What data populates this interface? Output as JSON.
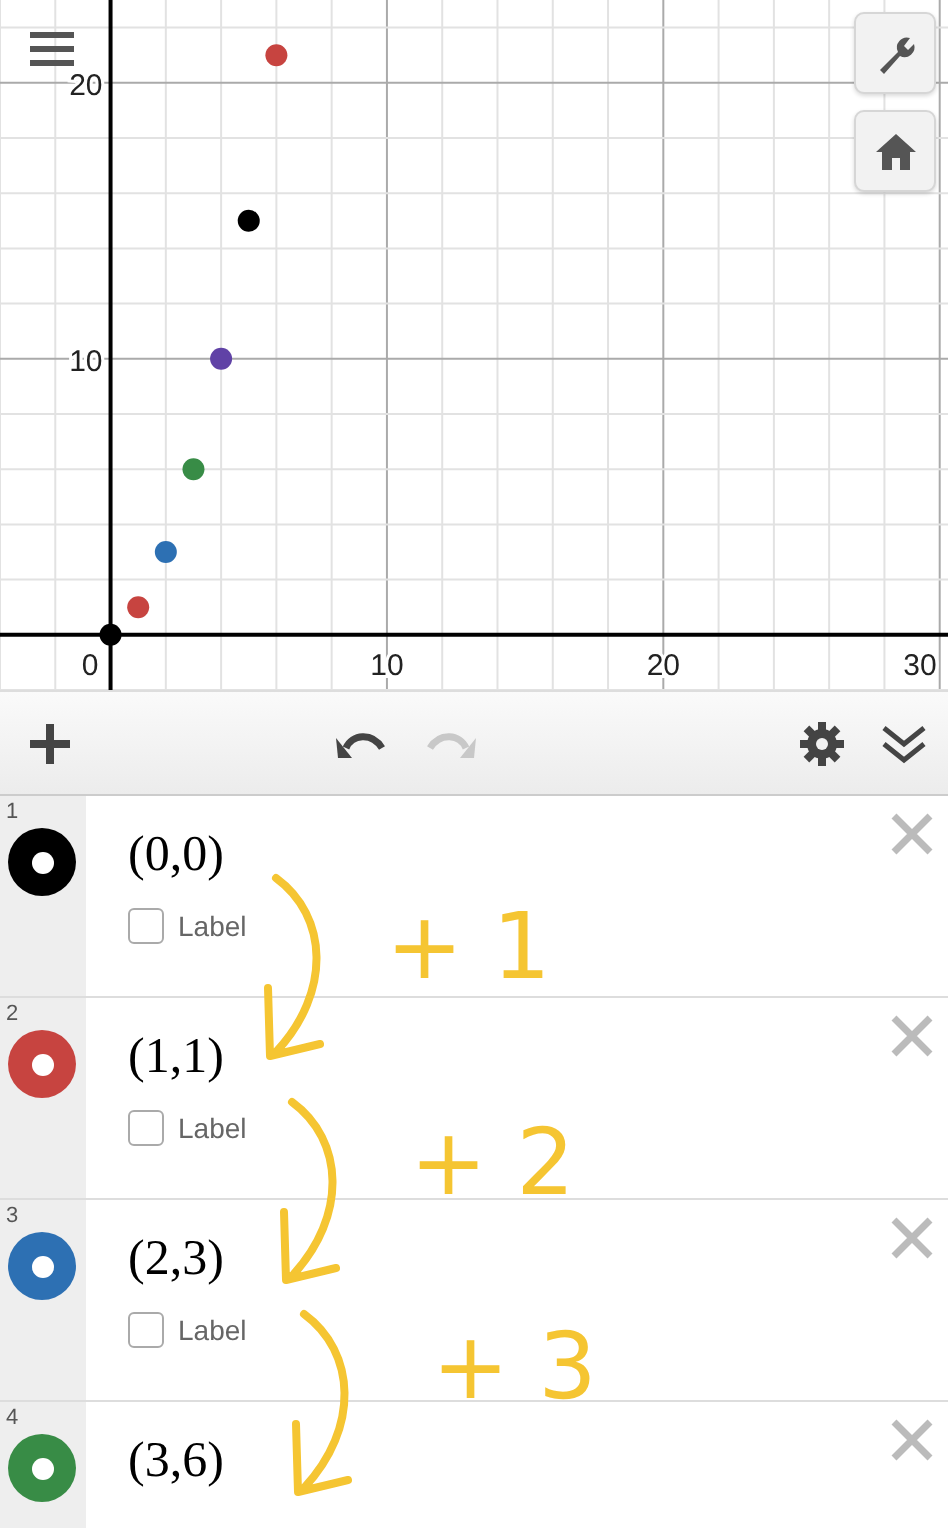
{
  "graph": {
    "chart_data": {
      "type": "scatter",
      "x": [
        0,
        1,
        2,
        3,
        4,
        5,
        6
      ],
      "grid": true,
      "series": [
        {
          "color": "#000000",
          "values": [
            0,
            null,
            null,
            null,
            null,
            15,
            null
          ]
        },
        {
          "color": "#c74440",
          "values": [
            null,
            1,
            null,
            null,
            null,
            null,
            21
          ]
        },
        {
          "color": "#2d70b3",
          "values": [
            null,
            null,
            3,
            null,
            null,
            null,
            null
          ]
        },
        {
          "color": "#388c46",
          "values": [
            null,
            null,
            null,
            6,
            null,
            null,
            null
          ]
        },
        {
          "color": "#6042a6",
          "values": [
            null,
            null,
            null,
            null,
            10,
            null,
            null
          ]
        }
      ],
      "xlim": [
        -4,
        30.3
      ],
      "ylim": [
        -2,
        23
      ],
      "xticks": [
        0,
        10,
        20,
        30
      ],
      "yticks": [
        10,
        20
      ]
    }
  },
  "toolbar": {
    "undo_disabled": false,
    "redo_disabled": true
  },
  "expressions": [
    {
      "number": "1",
      "color": "#000000",
      "expression": "(0,0)",
      "label": {
        "text": "Label",
        "checked": false
      }
    },
    {
      "number": "2",
      "color": "#c74440",
      "expression": "(1,1)",
      "label": {
        "text": "Label",
        "checked": false
      }
    },
    {
      "number": "3",
      "color": "#2d70b3",
      "expression": "(2,3)",
      "label": {
        "text": "Label",
        "checked": false
      }
    },
    {
      "number": "4",
      "color": "#388c46",
      "expression": "(3,6)"
    }
  ],
  "annotations": [
    {
      "text": "+ 1"
    },
    {
      "text": "+ 2"
    },
    {
      "text": "+ 3"
    }
  ]
}
